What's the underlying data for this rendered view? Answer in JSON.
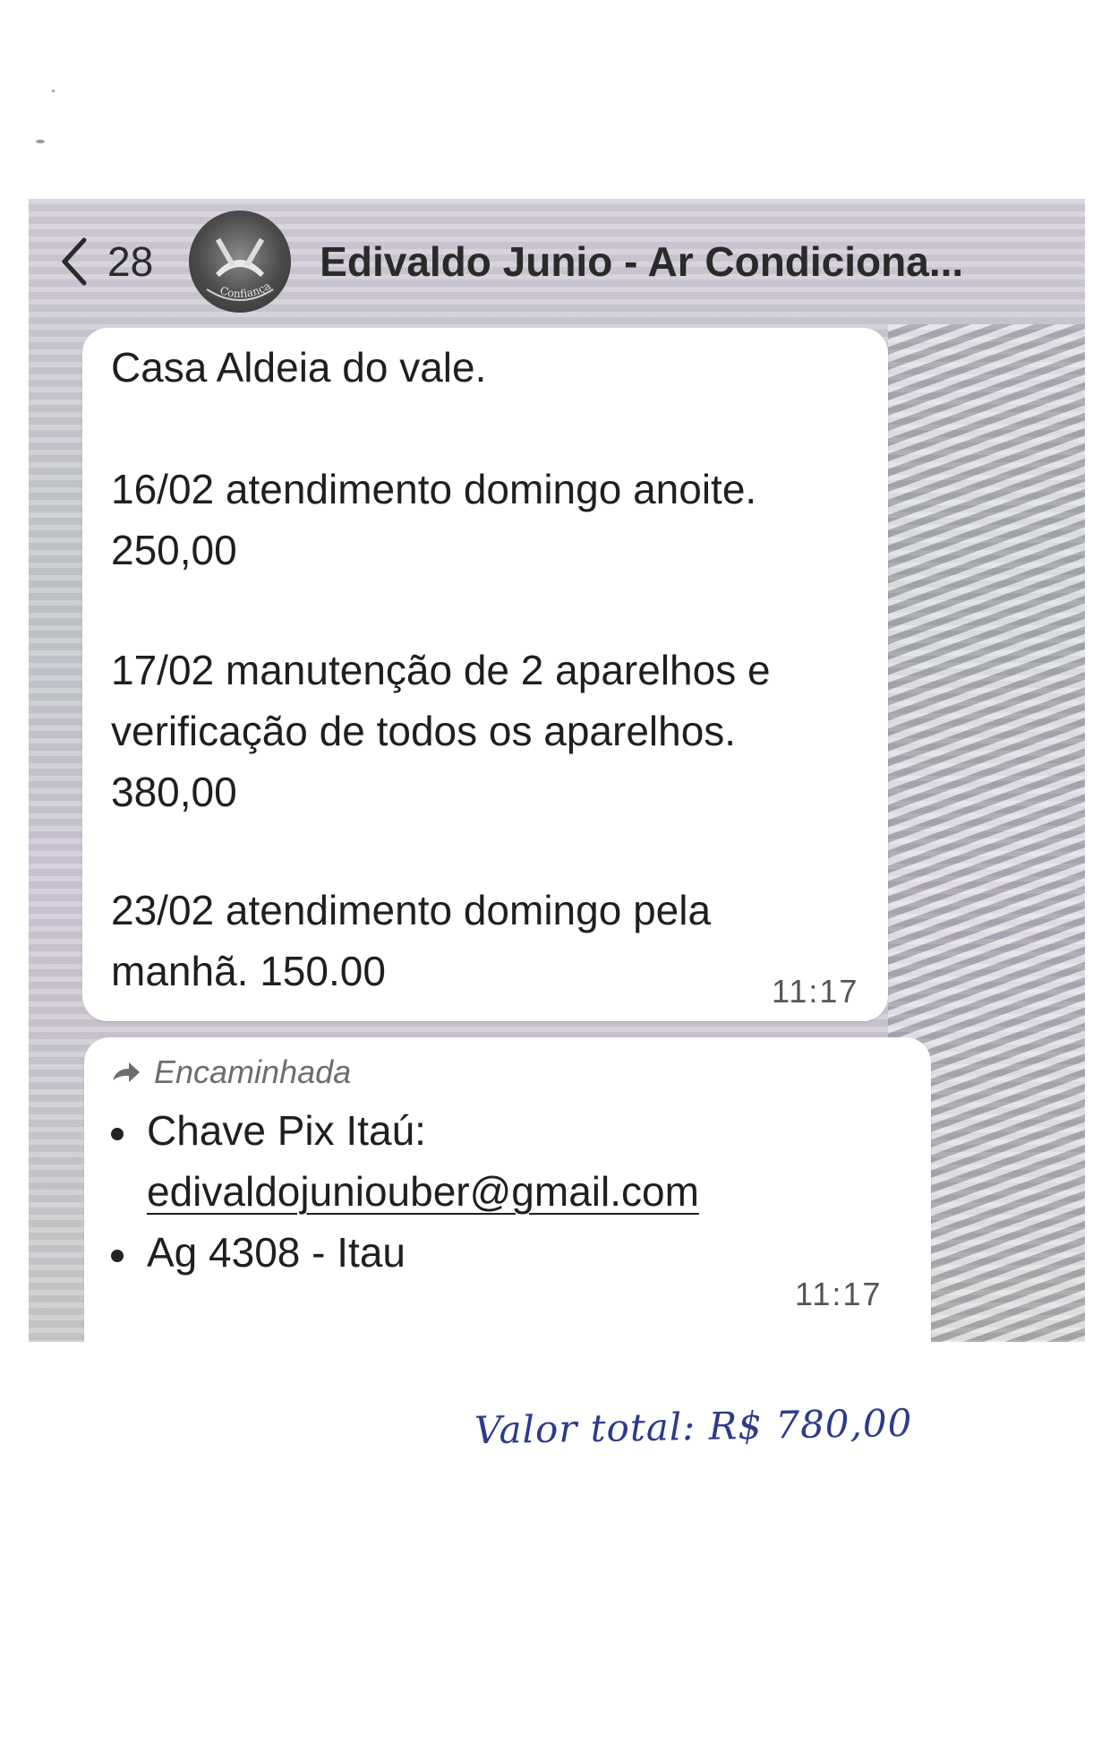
{
  "header": {
    "back_count": "28",
    "contact_name": "Edivaldo Junio - Ar Condiciona...",
    "avatar_text": "Confiança"
  },
  "messages": [
    {
      "lines": [
        "Casa Aldeia do vale.",
        "16/02 atendimento domingo anoite.",
        "250,00",
        "17/02 manutenção de 2 aparelhos e",
        "verificação de todos os aparelhos.",
        "380,00",
        "23/02 atendimento domingo pela",
        "manhã. 150.00"
      ],
      "time": "11:17"
    },
    {
      "forwarded_label": "Encaminhada",
      "bullet_1_text": "Chave Pix Itaú:",
      "email": "edivaldojuniouber@gmail.com",
      "bullet_2_text": "Ag 4308 - Itau",
      "time": "11:17"
    }
  ],
  "annotation": {
    "handwritten": "Valor total: R$ 780,00"
  },
  "colors": {
    "bubble": "#ffffff",
    "handwriting_ink": "#2d3a8c",
    "forward_label": "#6d6d6d"
  },
  "icons": {
    "back": "chevron-left-icon",
    "forward": "forward-arrow-icon"
  }
}
